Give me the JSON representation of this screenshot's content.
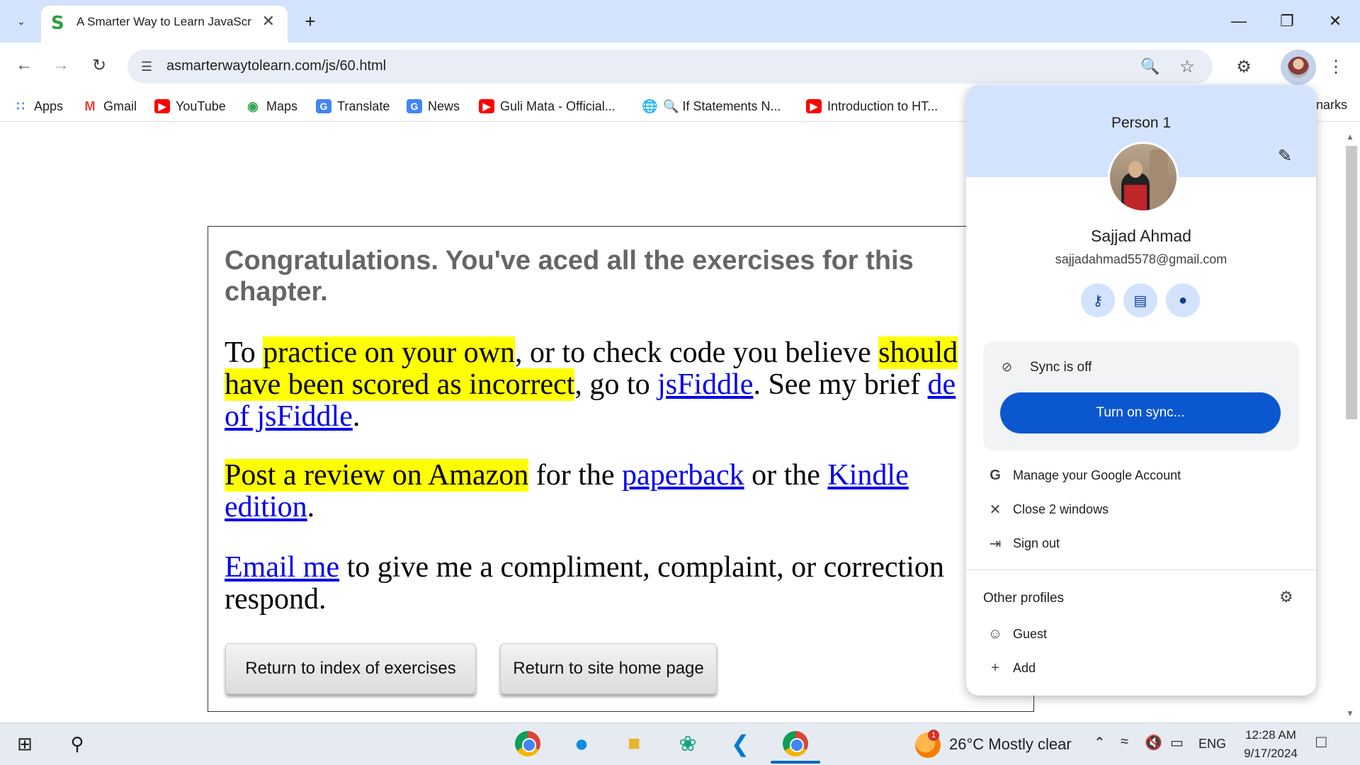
{
  "browser": {
    "tab_title": "A Smarter Way to Learn JavaScr",
    "tab_favicon": "S",
    "url": "asmarterwaytolearn.com/js/60.html"
  },
  "bookmarks": [
    {
      "label": "Apps",
      "icon": "apps-grid-icon",
      "color": "#4285f4"
    },
    {
      "label": "Gmail",
      "icon": "gmail-icon",
      "color": "#ea4335"
    },
    {
      "label": "YouTube",
      "icon": "youtube-icon",
      "color": "#ff0000"
    },
    {
      "label": "Maps",
      "icon": "maps-icon",
      "color": "#34a853"
    },
    {
      "label": "Translate",
      "icon": "translate-icon",
      "color": "#4285f4"
    },
    {
      "label": "News",
      "icon": "news-icon",
      "color": "#4285f4"
    },
    {
      "label": "Guli Mata - Official...",
      "icon": "youtube-icon",
      "color": "#ff0000"
    },
    {
      "label": "🔍 If Statements N...",
      "icon": "globe-icon",
      "color": "#5f6368"
    },
    {
      "label": "Introduction to HT...",
      "icon": "youtube-icon",
      "color": "#ff0000"
    }
  ],
  "bookmarks_overflow": "narks",
  "page": {
    "congrats": "Congratulations. You've aced all the exercises for this chapter.",
    "p1": {
      "to": "To ",
      "practice": "practice on your own",
      "mid": ", or to check code you believe ",
      "should": "should",
      "have_been": "have been scored as incorrect",
      "go_to": ", go to ",
      "jsfiddle": "jsFiddle",
      "see_brief": ". See my brief ",
      "demo": "de",
      "of_jsfiddle": "of jsFiddle",
      "period": "."
    },
    "p2": {
      "post": "Post a review on Amazon",
      "for_the": " for the ",
      "paperback": "paperback",
      "or_the": " or the ",
      "kindle": "Kindle",
      "edition": "edition",
      "period": "."
    },
    "p3": {
      "email": "Email me",
      "rest": " to give me a compliment, complaint, or correction",
      "respond": "respond."
    },
    "btn_index": "Return to index of exercises",
    "btn_home": "Return to site home page"
  },
  "profile": {
    "title": "Person 1",
    "name": "Sajjad Ahmad",
    "email": "sajjadahmad5578@gmail.com",
    "sync_status": "Sync is off",
    "sync_button": "Turn on sync...",
    "menu": [
      {
        "label": "Manage your Google Account",
        "icon": "google-g-icon"
      },
      {
        "label": "Close 2 windows",
        "icon": "close-icon"
      },
      {
        "label": "Sign out",
        "icon": "sign-out-icon"
      }
    ],
    "other_profiles_heading": "Other profiles",
    "others": [
      {
        "label": "Guest",
        "icon": "guest-icon"
      },
      {
        "label": "Add",
        "icon": "plus-icon"
      }
    ]
  },
  "taskbar": {
    "weather_temp": "26°C",
    "weather_desc": "Mostly clear",
    "weather_badge": "1",
    "language": "ENG",
    "time": "12:28 AM",
    "date": "9/17/2024"
  }
}
